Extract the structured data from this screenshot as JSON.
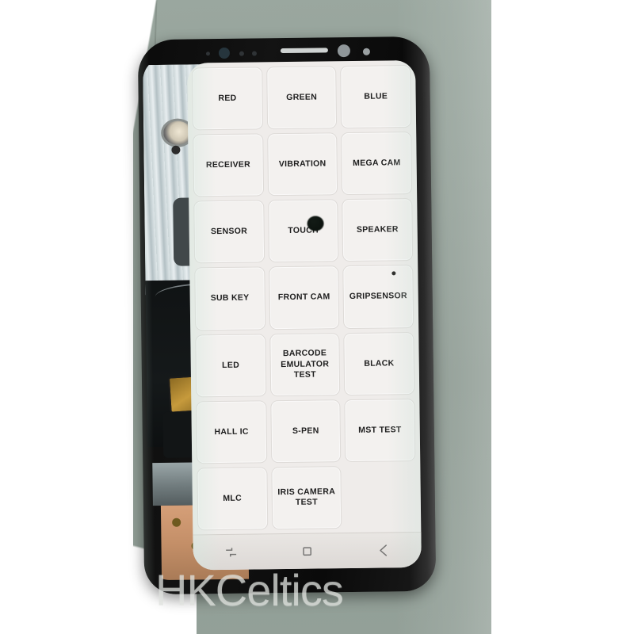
{
  "photo": {
    "subject": "Samsung Galaxy Note 8 display panel running factory hardware self-test grid",
    "watermark": "HKCeltics",
    "background_color": "#93a098",
    "tape_color": "#1f93ab"
  },
  "device": {
    "body_color": "#0f0f0f",
    "screen_bg": "#efecea",
    "bezel_items": [
      "iris-sensor-dot",
      "iris-camera",
      "proximity-sensor-dot",
      "light-sensor-dot",
      "earpiece-speaker-slot",
      "front-camera",
      "led-indicator"
    ]
  },
  "test_grid": {
    "columns": 3,
    "rows": 7,
    "cells": [
      {
        "label": "RED"
      },
      {
        "label": "GREEN"
      },
      {
        "label": "BLUE"
      },
      {
        "label": "RECEIVER"
      },
      {
        "label": "VIBRATION"
      },
      {
        "label": "MEGA CAM"
      },
      {
        "label": "SENSOR"
      },
      {
        "label": "TOUCH"
      },
      {
        "label": "SPEAKER"
      },
      {
        "label": "SUB KEY"
      },
      {
        "label": "FRONT CAM"
      },
      {
        "label": "GRIPSENSOR"
      },
      {
        "label": "LED"
      },
      {
        "label": "BARCODE EMULATOR TEST"
      },
      {
        "label": "BLACK"
      },
      {
        "label": "HALL IC"
      },
      {
        "label": "S-PEN"
      },
      {
        "label": "MST TEST"
      },
      {
        "label": "MLC"
      },
      {
        "label": "IRIS CAMERA TEST"
      },
      {
        "label": ""
      }
    ]
  },
  "navbar": {
    "buttons": [
      {
        "name": "recents",
        "icon": "recents-icon"
      },
      {
        "name": "home",
        "icon": "home-square-icon"
      },
      {
        "name": "back",
        "icon": "back-arrow-icon"
      }
    ]
  }
}
